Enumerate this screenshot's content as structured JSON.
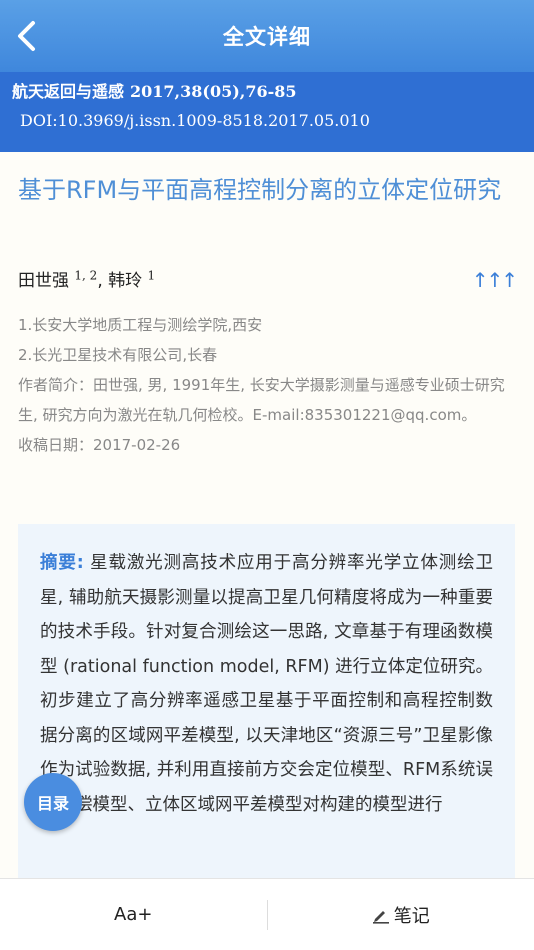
{
  "header": {
    "title": "全文详细"
  },
  "article_info": {
    "journal": "航天返回与遥感",
    "citation": "2017,38(05),76-85",
    "doi": "DOI:10.3969/j.issn.1009-8518.2017.05.010"
  },
  "article": {
    "title": "基于RFM与平面高程控制分离的立体定位研究",
    "authors": [
      {
        "name": "田世强",
        "affil": "1, 2"
      },
      {
        "name": "韩玲",
        "affil": "1"
      }
    ],
    "author_sep": ",",
    "expand_label": "↑↑↑",
    "affiliations": [
      "1.长安大学地质工程与测绘学院,西安",
      "2.长光卫星技术有限公司,长春"
    ],
    "bio": "作者简介：田世强, 男, 1991年生, 长安大学摄影测量与遥感专业硕士研究生, 研究方向为激光在轨几何检校。E-mail:835301221@qq.com。",
    "received": "收稿日期：2017-02-26"
  },
  "abstract": {
    "label": "摘要:",
    "text": " 星载激光测高技术应用于高分辨率光学立体测绘卫星, 辅助航天摄影测量以提高卫星几何精度将成为一种重要的技术手段。针对复合测绘这一思路, 文章基于有理函数模型 (rational function model, RFM) 进行立体定位研究。初步建立了高分辨率遥感卫星基于平面控制和高程控制数据分离的区域网平差模型, 以天津地区“资源三号”卫星影像作为试验数据, 并利用直接前方交会定位模型、RFM系统误差补偿模型、立体区域网平差模型对构建的模型进行"
  },
  "toc_button": {
    "label": "目录"
  },
  "bottom": {
    "font_label": "Aa+",
    "notes_label": "笔记"
  }
}
